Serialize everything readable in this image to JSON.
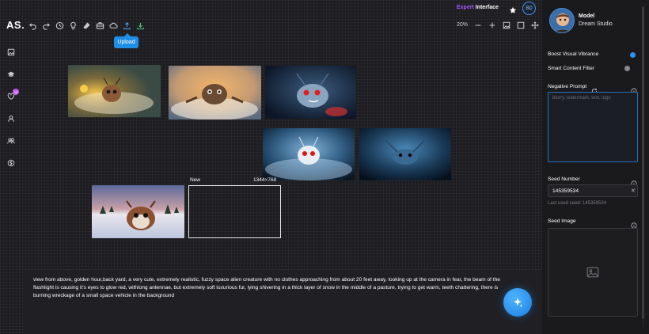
{
  "app": {
    "logo": "AS",
    "logo_dot": "."
  },
  "toolbar": {
    "buttons": [
      {
        "name": "undo-icon"
      },
      {
        "name": "redo-icon"
      },
      {
        "name": "history-icon"
      },
      {
        "name": "lightbulb-icon"
      },
      {
        "name": "eraser-icon"
      },
      {
        "name": "briefcase-icon"
      },
      {
        "name": "cloud-icon"
      },
      {
        "name": "upload-icon"
      },
      {
        "name": "download-icon"
      }
    ],
    "tooltip": "Upload"
  },
  "header": {
    "mode_prefix": "Expert",
    "mode_suffix": "Interface",
    "avatar_initials": "BD"
  },
  "zoom": {
    "value": "20%"
  },
  "canvas": {
    "new_frame_label": "New",
    "new_frame_size": "1344×768"
  },
  "prompt": {
    "text": "view from above, golden hour,back yard, a very cute, extremely realistic, fuzzy space alien creature with no clothes approaching from about 20 feet away, looking up at the camera in fear, the beam of the flashlight is causing it's eyes to glow red, withlong antennae, but extremely soft luxurious fur, lying shivering in a thick layer of snow in the middle of a pasture, trying to get warm, teeth chattering, there is burning wreckage of a small space vehicle in the background"
  },
  "panel": {
    "model_label": "Model",
    "model_name": "Dream Studio",
    "boost_label": "Boost Visual Vibrance",
    "smart_filter_label": "Smart Content Filter",
    "negative_prompt_label": "Negative Prompt",
    "negative_prompt_placeholder": "blurry, watermark, text, logo",
    "seed_number_label": "Seed Number",
    "seed_value": "145359534",
    "last_seed_text": "Last used seed: 145359534",
    "seed_image_label": "Seed Image"
  },
  "left_rail": {
    "badge": "13"
  },
  "colors": {
    "accent": "#1f8fe6",
    "purple": "#a259ff",
    "green": "#4cbf73"
  }
}
